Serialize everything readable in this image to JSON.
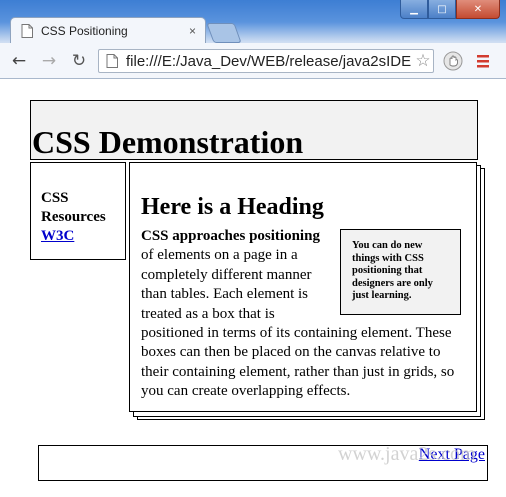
{
  "browser": {
    "tab_title": "CSS Positioning",
    "tab_close": "×",
    "url": "file:///E:/Java_Dev/WEB/release/java2sIDE",
    "back_glyph": "←",
    "forward_glyph": "→",
    "reload_glyph": "↻",
    "star_glyph": "☆",
    "minimize_glyph": "▁",
    "maximize_glyph": "□",
    "close_glyph": "✕",
    "icons": [
      "page-icon",
      "back-arrow-icon",
      "forward-arrow-icon",
      "reload-icon",
      "star-icon",
      "extension-icon",
      "menu-icon"
    ]
  },
  "page": {
    "site_title": "CSS Demonstration",
    "sidebar": {
      "line1": "CSS",
      "line2": "Resources",
      "link": "W3C"
    },
    "content": {
      "heading": "Here is a Heading",
      "callout": "You can do new things with CSS positioning that designers are only just learning.",
      "lead_bold": "CSS approaches positioning",
      "body": " of elements on a page in a completely different manner than tables. Each element is treated as a box that is positioned in terms of its containing element. These boxes can then be placed on the canvas relative to their containing element, rather than just in grids, so you can create overlapping effects."
    },
    "footer": {
      "next_link": "Next Page",
      "watermark": "www.java2s.com"
    }
  },
  "colors": {
    "chrome_blue": "#3d7ed3",
    "link": "#0000cc",
    "box_fill": "#f2f2f2",
    "menu_red": "#d23b2f"
  }
}
